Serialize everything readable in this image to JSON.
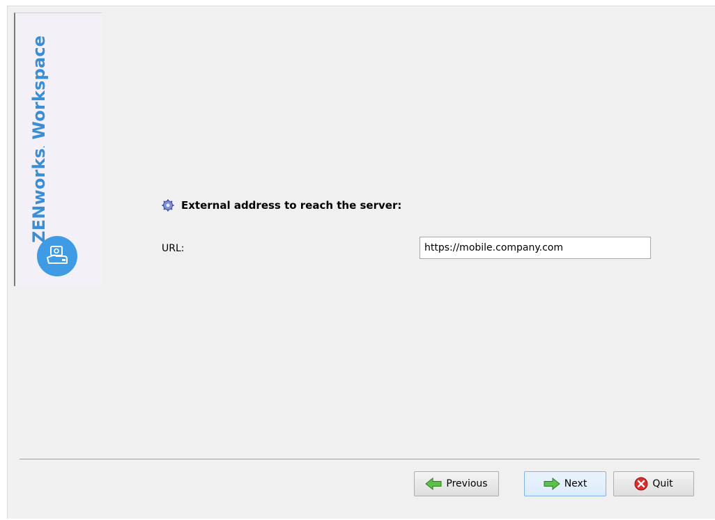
{
  "brand": {
    "name": "ZENworks",
    "trademark": ".",
    "product": " Workspace",
    "accent_color": "#3a8ed6",
    "logo_icon": "device-hand-icon"
  },
  "section": {
    "icon": "gear-icon",
    "heading": "External address to reach the server:"
  },
  "form": {
    "url_label": "URL:",
    "url_value": "https://mobile.company.com"
  },
  "buttons": {
    "previous": {
      "label": "Previous",
      "icon": "arrow-left-icon"
    },
    "next": {
      "label": "Next",
      "icon": "arrow-right-icon"
    },
    "quit": {
      "label": "Quit",
      "icon": "close-circle-icon"
    }
  }
}
